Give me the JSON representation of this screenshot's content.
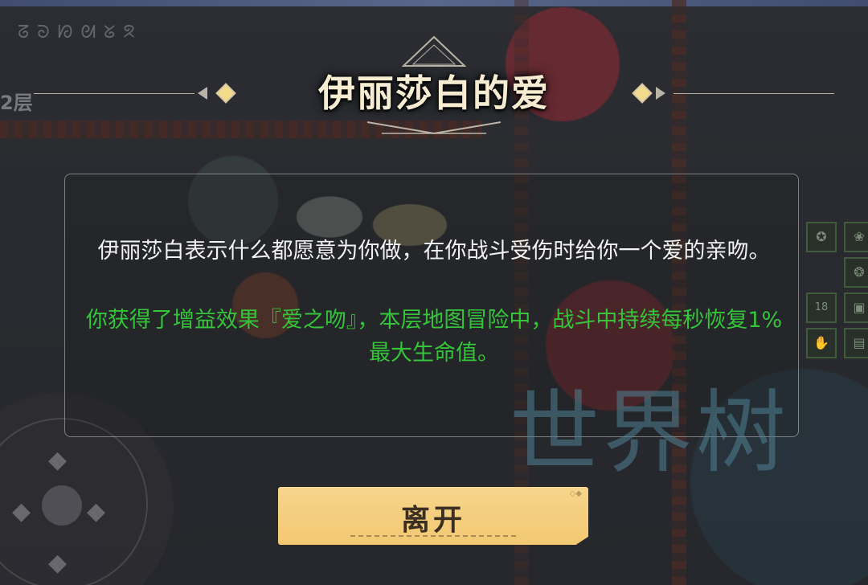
{
  "hud": {
    "floor_label": "2层",
    "runes": "ᘔᘐᘗᘛᘜᘝ",
    "skill_count": "18"
  },
  "dialog": {
    "title": "伊丽莎白的爱",
    "description": "伊丽莎白表示什么都愿意为你做，在你战斗受伤时给你一个爱的亲吻。",
    "buff": "你获得了增益效果『爱之吻』，本层地图冒险中，战斗中持续每秒恢复1%最大生命值。",
    "leave_button": "离开"
  },
  "watermark": "世界树",
  "colors": {
    "body_text": "#f2f2f2",
    "buff_text": "#35c43a",
    "button": "#f2c872",
    "title": "#f6ecd2"
  },
  "icons": [
    "skill-icon",
    "joystick-icon",
    "crest-icon"
  ]
}
